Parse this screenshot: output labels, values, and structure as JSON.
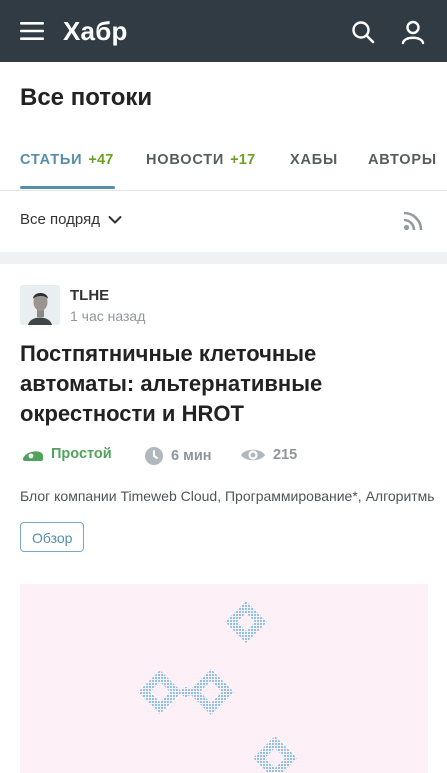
{
  "header": {
    "logo": "Хабр",
    "menu_icon": "hamburger-menu-icon",
    "search_icon": "search-icon",
    "user_icon": "user-icon"
  },
  "page": {
    "title": "Все потоки"
  },
  "tabs": [
    {
      "label": "СТАТЬИ",
      "count": "+47",
      "active": true
    },
    {
      "label": "НОВОСТИ",
      "count": "+17",
      "active": false
    },
    {
      "label": "ХАБЫ",
      "count": "",
      "active": false
    },
    {
      "label": "АВТОРЫ",
      "count": "",
      "active": false
    }
  ],
  "filter": {
    "label": "Все подряд",
    "rss_icon": "rss-icon"
  },
  "article": {
    "author": "TLHE",
    "time": "1 час назад",
    "title": "Постпятничные клеточные автоматы: альтернативные окрестности и HROT",
    "difficulty": "Простой",
    "reading_time": "6 мин",
    "views": "215",
    "hubs": "Блог компании Timeweb Cloud, Программирование*, Алгоритмы*",
    "tag": "Обзор"
  },
  "colors": {
    "header_bg": "#303b44",
    "accent": "#548eaa",
    "count_green": "#6aa122",
    "difficulty_green": "#4fa35d",
    "muted": "#909699",
    "cover_bg": "#fdf1f7",
    "cover_pattern": "#8ec3e6"
  }
}
